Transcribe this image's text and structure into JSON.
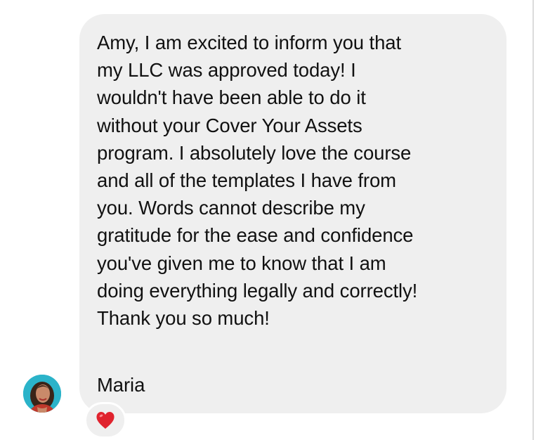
{
  "message": {
    "body": "Amy, I am excited to inform you that\nmy LLC was approved today! I\nwouldn't have been able to do it\nwithout your Cover Your Assets\nprogram. I absolutely love the course\nand all of the templates I have from\nyou. Words cannot describe my\ngratitude for the ease and confidence\nyou've given me to know that I am\ndoing everything legally and correctly!\nThank you so much!",
    "signature": "Maria",
    "reaction_icon": "red-heart-icon"
  },
  "sender": {
    "avatar_icon": "profile-photo-avatar"
  },
  "colors": {
    "bubble_background": "#efefef",
    "text": "#111111",
    "reaction_heart": "#e0232e",
    "avatar_background": "#2bb3c9"
  }
}
